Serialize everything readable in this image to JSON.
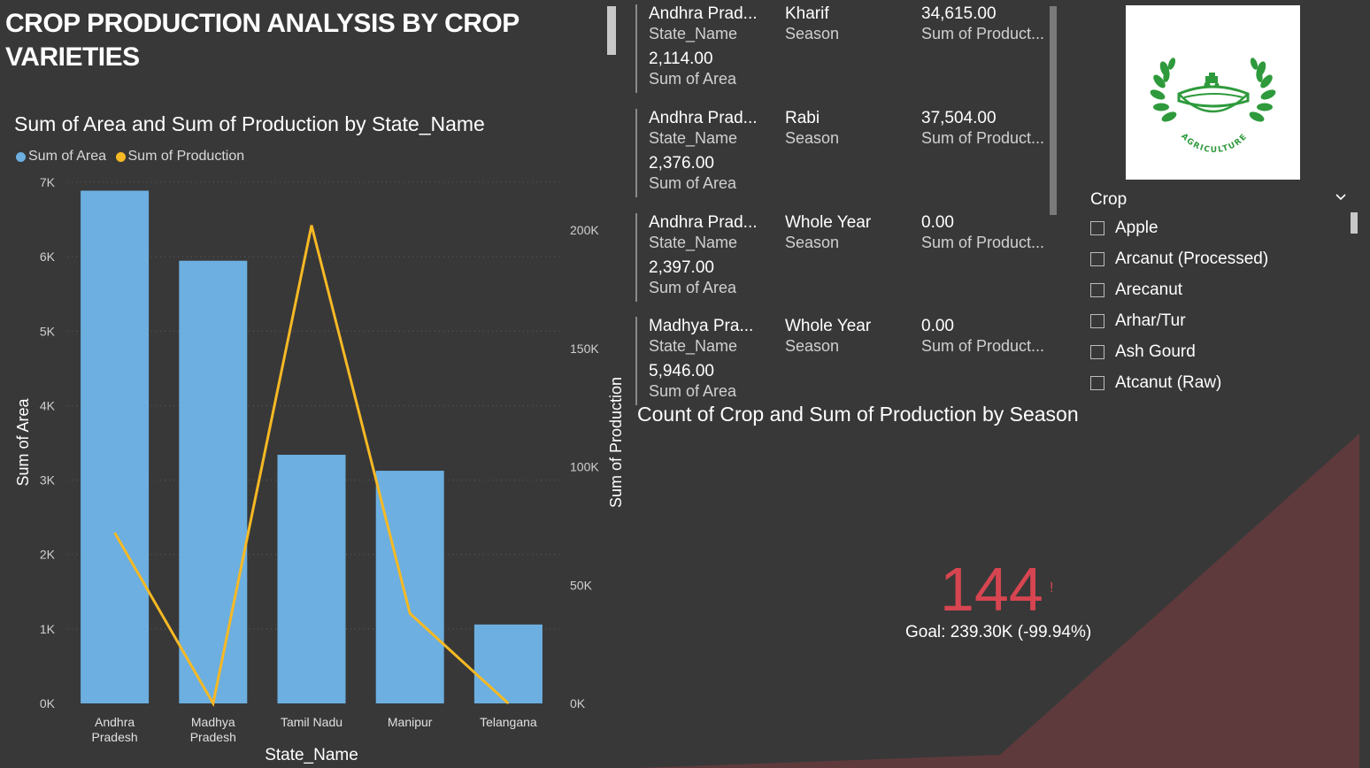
{
  "page_title": "CROP PRODUCTION ANALYSIS BY CROP VARIETIES",
  "colors": {
    "background": "#383838",
    "area_series": "#6cafe0",
    "production_series": "#f7b924",
    "kpi_value": "#d64550",
    "kpi_trend": "#5e3a3d",
    "logo_green": "#2e9a3c"
  },
  "combo": {
    "title": "Sum of Area and Sum of Production by State_Name",
    "legend": [
      "Sum of Area",
      "Sum of Production"
    ]
  },
  "chart_data": {
    "type": "bar",
    "title": "Sum of Area and Sum of Production by State_Name",
    "xlabel": "State_Name",
    "ylabel": "Sum of Area",
    "y2label": "Sum of Production",
    "categories": [
      "Andhra Pradesh",
      "Madhya Pradesh",
      "Tamil Nadu",
      "Manipur",
      "Telangana"
    ],
    "category_lines": [
      [
        "Andhra",
        "Pradesh"
      ],
      [
        "Madhya",
        "Pradesh"
      ],
      [
        "Tamil Nadu"
      ],
      [
        "Manipur"
      ],
      [
        "Telangana"
      ]
    ],
    "series": [
      {
        "name": "Sum of Area",
        "type": "bar",
        "axis": "left",
        "values": [
          6887,
          5946,
          3340,
          3125,
          1060
        ]
      },
      {
        "name": "Sum of Production",
        "type": "line",
        "axis": "right",
        "values": [
          72119,
          0,
          202000,
          38000,
          0
        ]
      }
    ],
    "ylim": [
      0,
      7000
    ],
    "y2lim": [
      0,
      220000
    ],
    "yticks": [
      0,
      1000,
      2000,
      3000,
      4000,
      5000,
      6000,
      7000
    ],
    "yticklabels": [
      "0K",
      "1K",
      "2K",
      "3K",
      "4K",
      "5K",
      "6K",
      "7K"
    ],
    "y2ticks": [
      0,
      50000,
      100000,
      150000,
      200000
    ],
    "y2ticklabels": [
      "0K",
      "50K",
      "100K",
      "150K",
      "200K"
    ],
    "grid": true,
    "legend_position": "top-left"
  },
  "card": {
    "labels": {
      "state": "State_Name",
      "season": "Season",
      "production": "Sum of Product...",
      "area": "Sum of Area"
    },
    "rows": [
      {
        "state": "Andhra Prad...",
        "season": "Kharif",
        "production": "34,615.00",
        "area": "2,114.00"
      },
      {
        "state": "Andhra Prad...",
        "season": "Rabi",
        "production": "37,504.00",
        "area": "2,376.00"
      },
      {
        "state": "Andhra Prad...",
        "season": "Whole Year",
        "production": "0.00",
        "area": "2,397.00"
      },
      {
        "state": "Madhya Pra...",
        "season": "Whole Year",
        "production": "0.00",
        "area": "5,946.00"
      }
    ]
  },
  "logo": {
    "text": "AGRICULTURE"
  },
  "slicer": {
    "title": "Crop",
    "items": [
      "Apple",
      "Arcanut (Processed)",
      "Arecanut",
      "Arhar/Tur",
      "Ash Gourd",
      "Atcanut (Raw)"
    ]
  },
  "kpi": {
    "title": "Count of Crop and Sum of Production by Season",
    "value": "144",
    "alert": "!",
    "goal": "Goal: 239.30K (-99.94%)"
  }
}
